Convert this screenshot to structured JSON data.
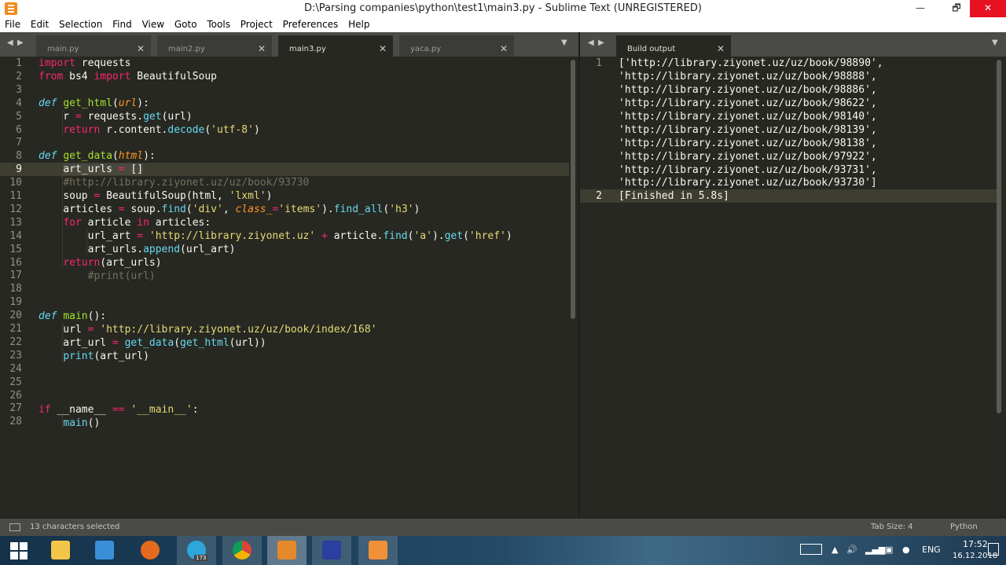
{
  "window": {
    "title": "D:\\Parsing companies\\python\\test1\\main3.py - Sublime Text (UNREGISTERED)",
    "minimize": "—",
    "maximize": "🗗",
    "close": "✕"
  },
  "menu": [
    "File",
    "Edit",
    "Selection",
    "Find",
    "View",
    "Goto",
    "Tools",
    "Project",
    "Preferences",
    "Help"
  ],
  "tabs": [
    {
      "label": "main.py",
      "active": false
    },
    {
      "label": "main2.py",
      "active": false
    },
    {
      "label": "main3.py",
      "active": true
    },
    {
      "label": "yaca.py",
      "active": false
    }
  ],
  "output_tab": {
    "label": "Build output"
  },
  "editor": {
    "line_numbers": [
      "1",
      "2",
      "3",
      "4",
      "5",
      "6",
      "7",
      "8",
      "9",
      "10",
      "11",
      "12",
      "13",
      "14",
      "15",
      "16",
      "17",
      "18",
      "19",
      "20",
      "21",
      "22",
      "23",
      "24",
      "25",
      "26",
      "27",
      "28"
    ],
    "current_line": 9
  },
  "output": {
    "line_numbers": [
      "1",
      "2"
    ],
    "lines": [
      "['http://library.ziyonet.uz/uz/book/98890',",
      "'http://library.ziyonet.uz/uz/book/98888',",
      "'http://library.ziyonet.uz/uz/book/98886',",
      "'http://library.ziyonet.uz/uz/book/98622',",
      "'http://library.ziyonet.uz/uz/book/98140',",
      "'http://library.ziyonet.uz/uz/book/98139',",
      "'http://library.ziyonet.uz/uz/book/98138',",
      "'http://library.ziyonet.uz/uz/book/97922',",
      "'http://library.ziyonet.uz/uz/book/93731',",
      "'http://library.ziyonet.uz/uz/book/93730']",
      "[Finished in 5.8s]"
    ]
  },
  "status": {
    "left": "13 characters selected",
    "tab_size": "Tab Size: 4",
    "syntax": "Python"
  },
  "taskbar": {
    "lang": "ENG",
    "time": "17:52",
    "date": "16.12.2018",
    "telegram_badge": "173"
  }
}
